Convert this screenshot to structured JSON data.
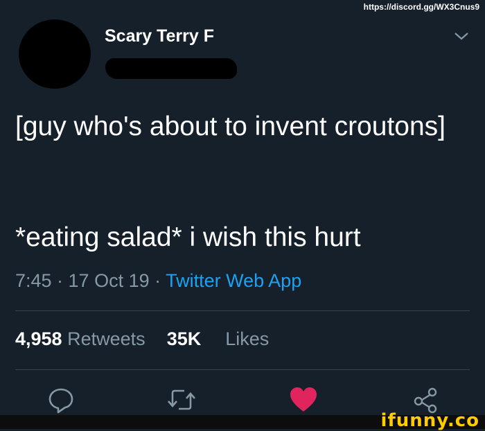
{
  "watermark": {
    "url": "https://discord.gg/WX3Cnus9",
    "brand": "ifunny.co"
  },
  "tweet": {
    "display_name": "Scary Terry F",
    "text_line1": "[guy who's about to invent croutons]",
    "text_line2": "*eating salad* i wish this hurt",
    "time": "7:45 · 17 Oct 19 · ",
    "source": "Twitter Web App",
    "retweets_count": "4,958",
    "retweets_label": "Retweets",
    "likes_count": "35K",
    "likes_label": "Likes"
  },
  "icons": {
    "chevron": "chevron-down-icon",
    "reply": "reply-icon",
    "retweet": "retweet-icon",
    "like": "heart-icon",
    "share": "share-icon"
  },
  "colors": {
    "background": "#15202b",
    "secondary_text": "#8899a6",
    "link": "#1da1f2",
    "like": "#e0245e",
    "brand": "#ffcc00"
  }
}
